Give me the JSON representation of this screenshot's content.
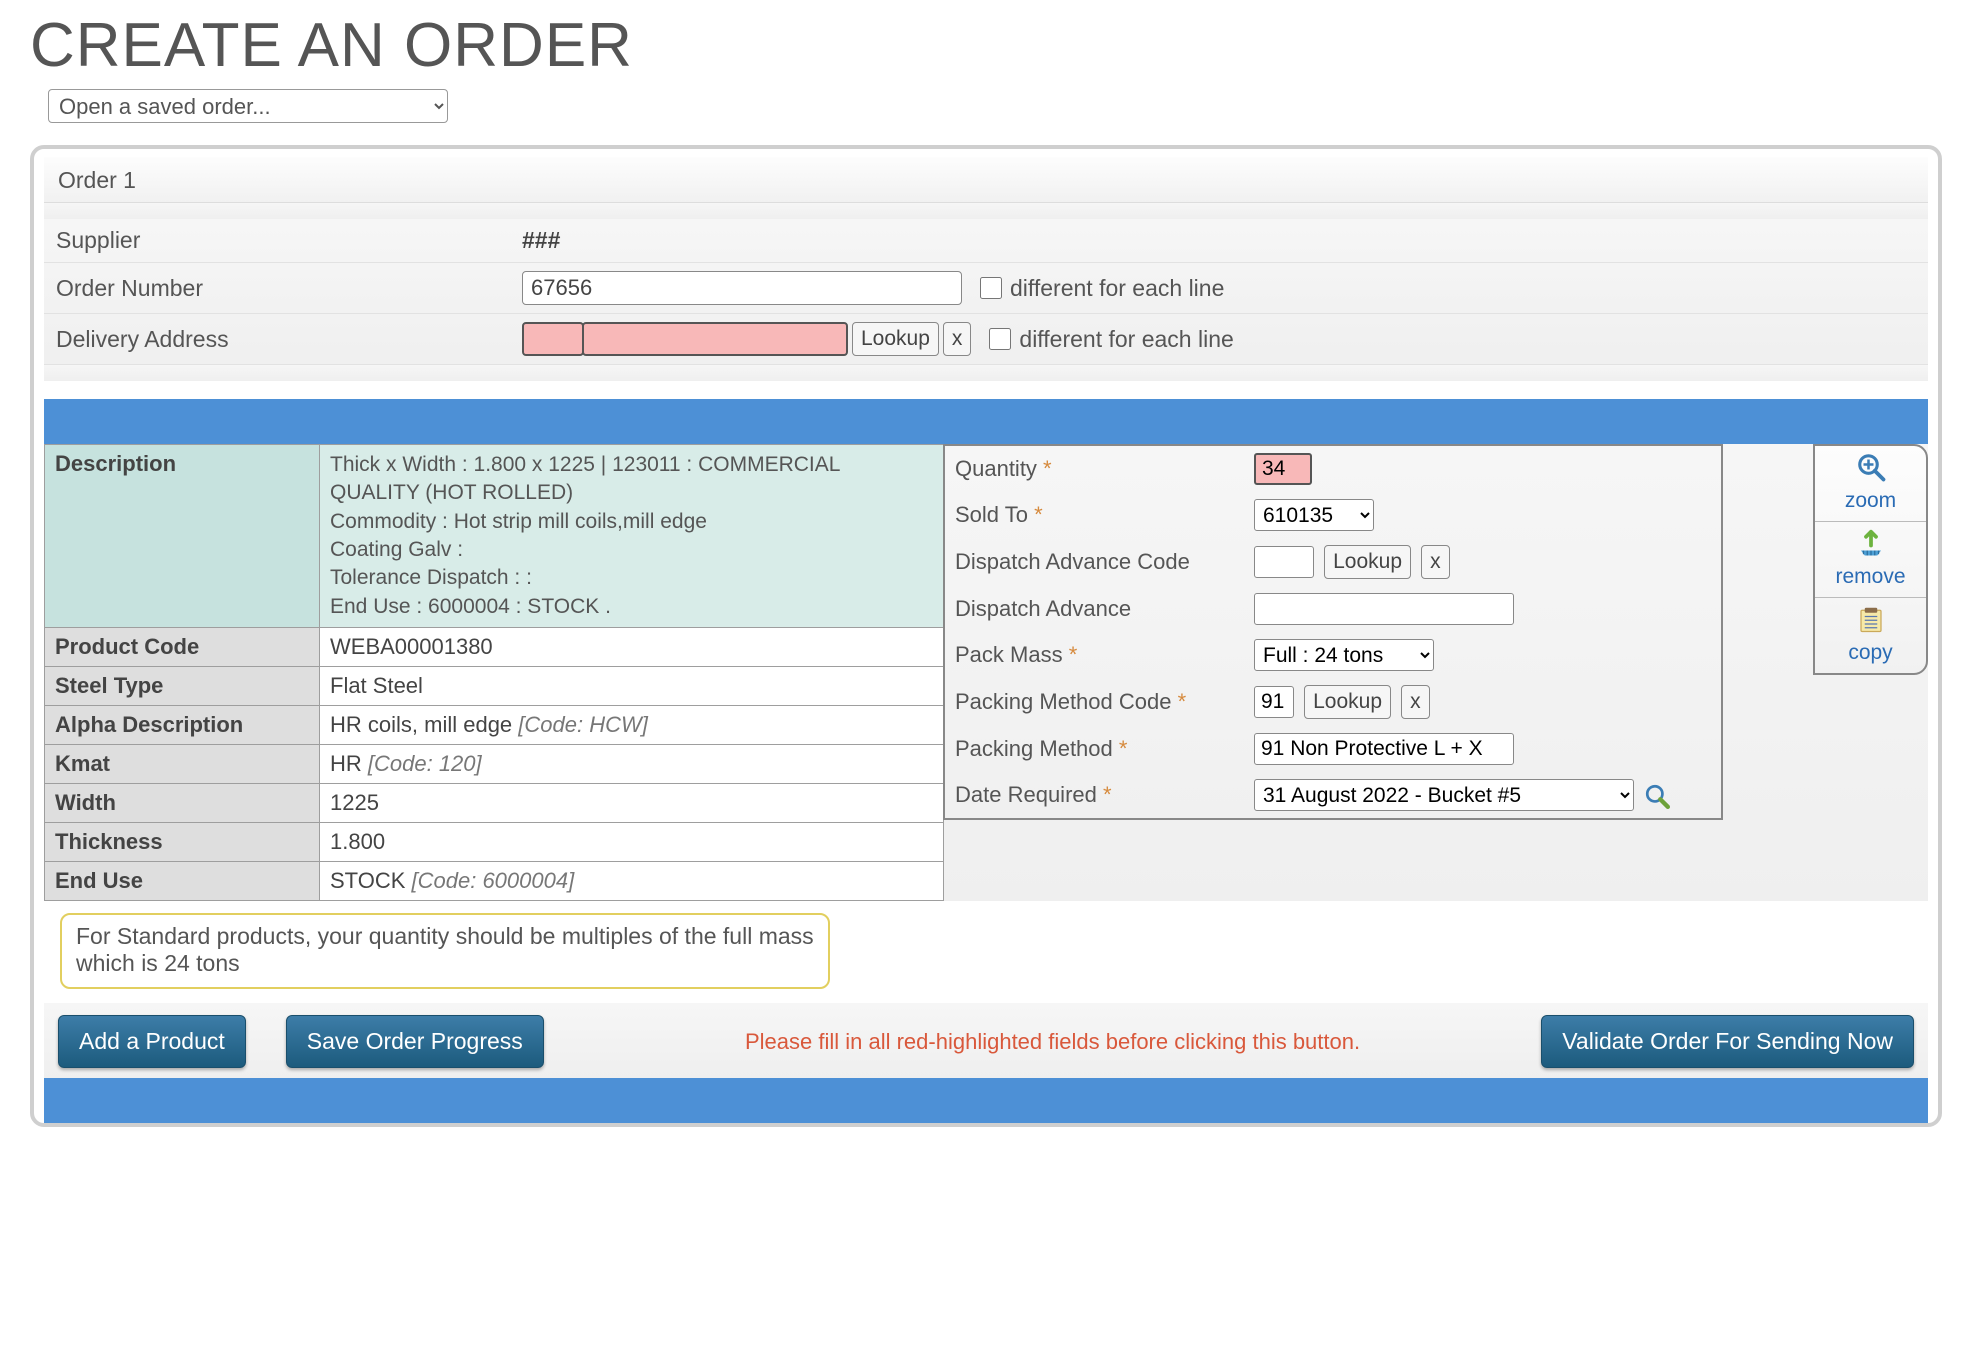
{
  "page_title": "CREATE AN ORDER",
  "saved_order_placeholder": "Open a saved order...",
  "order_tab": "Order 1",
  "header": {
    "supplier_label": "Supplier",
    "supplier_value": "###",
    "order_number_label": "Order Number",
    "order_number_value": "67656",
    "diff_line_label": "different for each line",
    "delivery_label": "Delivery Address",
    "lookup_label": "Lookup",
    "x_label": "x"
  },
  "left": {
    "description_label": "Description",
    "description_text": "Thick x Width : 1.800 x 1225 | 123011 : COMMERCIAL QUALITY (HOT ROLLED)\nCommodity : Hot strip mill coils,mill edge\nCoating Galv :\nTolerance Dispatch : :\nEnd Use : 6000004 : STOCK .",
    "rows": {
      "product_code_l": "Product Code",
      "product_code_v": "WEBA00001380",
      "steel_type_l": "Steel Type",
      "steel_type_v": "Flat Steel",
      "alpha_l": "Alpha Description",
      "alpha_v": "HR coils, mill edge ",
      "alpha_code": "[Code: HCW]",
      "kmat_l": "Kmat",
      "kmat_v": "HR ",
      "kmat_code": "[Code: 120]",
      "width_l": "Width",
      "width_v": "1225",
      "thick_l": "Thickness",
      "thick_v": "1.800",
      "enduse_l": "End Use",
      "enduse_v": "STOCK ",
      "enduse_code": "[Code: 6000004]"
    }
  },
  "right": {
    "qty_l": "Quantity ",
    "qty_v": "34",
    "soldto_l": "Sold To ",
    "soldto_v": "610135",
    "dac_l": "Dispatch Advance Code",
    "da_l": "Dispatch Advance",
    "pmass_l": "Pack Mass ",
    "pmass_v": "Full : 24 tons",
    "pmc_l": "Packing Method Code ",
    "pmc_v": "91",
    "pm_l": "Packing Method ",
    "pm_v": "91 Non Protective L + X",
    "date_l": "Date Required ",
    "date_v": "31 August 2022 - Bucket #5",
    "lookup": "Lookup",
    "x": "x"
  },
  "actions": {
    "zoom": "zoom",
    "remove": "remove",
    "copy": "copy"
  },
  "callout": "For Standard products, your quantity should be multiples of the full mass which is 24 tons",
  "footer": {
    "add": "Add a Product",
    "save": "Save Order Progress",
    "warn": "Please fill in all red-highlighted fields before clicking this button.",
    "validate": "Validate Order For Sending Now"
  }
}
